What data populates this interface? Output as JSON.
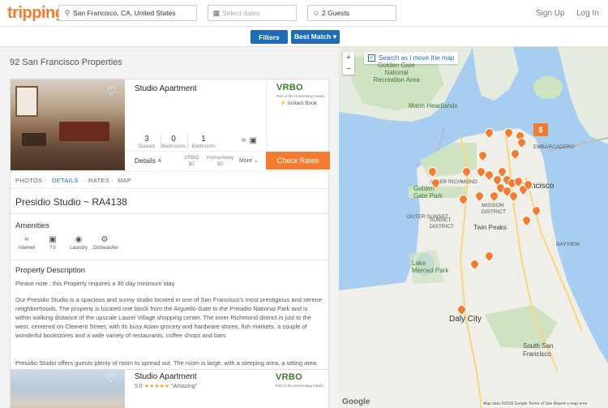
{
  "header": {
    "logo": "tripping",
    "location_value": "San Francisco, CA, United States",
    "dates_placeholder": "Select dates",
    "guests_value": "2 Guests",
    "sign_up": "Sign Up",
    "log_in": "Log In"
  },
  "filters": {
    "filters_label": "Filters",
    "sort_label": "Best Match ▾"
  },
  "results": {
    "count_label": "92 San Francisco Properties"
  },
  "listing1": {
    "title": "Studio Apartment",
    "stats": [
      {
        "value": "3",
        "label": "Guests"
      },
      {
        "value": "0",
        "label": "Bedrooms"
      },
      {
        "value": "1",
        "label": "Bathroom"
      }
    ],
    "details_label": "Details ˄",
    "prices": [
      {
        "site": "VRBO",
        "price": "$0"
      },
      {
        "site": "HomeAway",
        "price": "$0"
      }
    ],
    "more_label": "More ⌄",
    "provider": "VRBO",
    "provider_sub": "Part of the HomeAway Family",
    "instant_book": "Instant Book",
    "check_rates": "Check Rates",
    "tabs": [
      "PHOTOS",
      "DETAILS",
      "RATES",
      "MAP"
    ],
    "active_tab": "DETAILS",
    "property_title": "Presidio Studio ~ RA4138",
    "amenities_heading": "Amenities",
    "amenities": [
      "Internet",
      "TV",
      "Laundry",
      "Dishwasher"
    ],
    "description_heading": "Property Description",
    "note": "Please note : this Property requires a 30 day minimum stay",
    "description_p1": "Our Presidio Studio is a spacious and sunny studio located in one of San Francisco's most prestigious and serene neighborhoods. The property is located one block from the Arguello Gate to the Presidio National Park and is within walking distance of the upscale Laurel Village shopping center. The inner Richmond district is just to the west, centered on Clement Street, with its busy Asian grocery and hardware stores, fish markets, a couple of wonderful bookstores and a wide variety of restaurants, coffee shops and bars",
    "description_p2": "Presidio Studio offers guests plenty of room to spread out. The room is large, with a sleeping area, a sitting area and a bank of windows facing the garden. Glass doors open to a private deck overlooking the garden. There is a newly remodeled kitchen and a small dining area. The bathroom is large with a"
  },
  "listing2": {
    "title": "Studio Apartment",
    "rating": "5.0",
    "quote": "\"Amazing\"",
    "provider": "VRBO",
    "provider_sub": "Part of the HomeAway Family"
  },
  "map": {
    "zoom_in": "+",
    "zoom_out": "−",
    "search_move": "Search as I move the map",
    "price_marker": "$",
    "labels": {
      "nra": "Golden Gate\nNational\nRecreation Area",
      "marin": "Marin Headlands",
      "richmond": "INNER RICHMOND",
      "golden_gate_park": "Golden\nGate Park",
      "francisco": "Francisco",
      "mission": "MISSION\nDISTRICT",
      "twin_peaks": "Twin Peaks",
      "lake_merced": "Lake\nMerced Park",
      "daly_city": "Daly City",
      "south_sf": "South San\nFrancisco",
      "embarcadero": "EMBARCADERO",
      "outer_sunset": "OUTER SUNSET",
      "bayview": "BAYVIEW",
      "sunset_district": "SUNSET\nDISTRICT"
    },
    "google": "Google",
    "attribution": "Map data ©2018 Google   Terms of Use   Report a map error"
  }
}
